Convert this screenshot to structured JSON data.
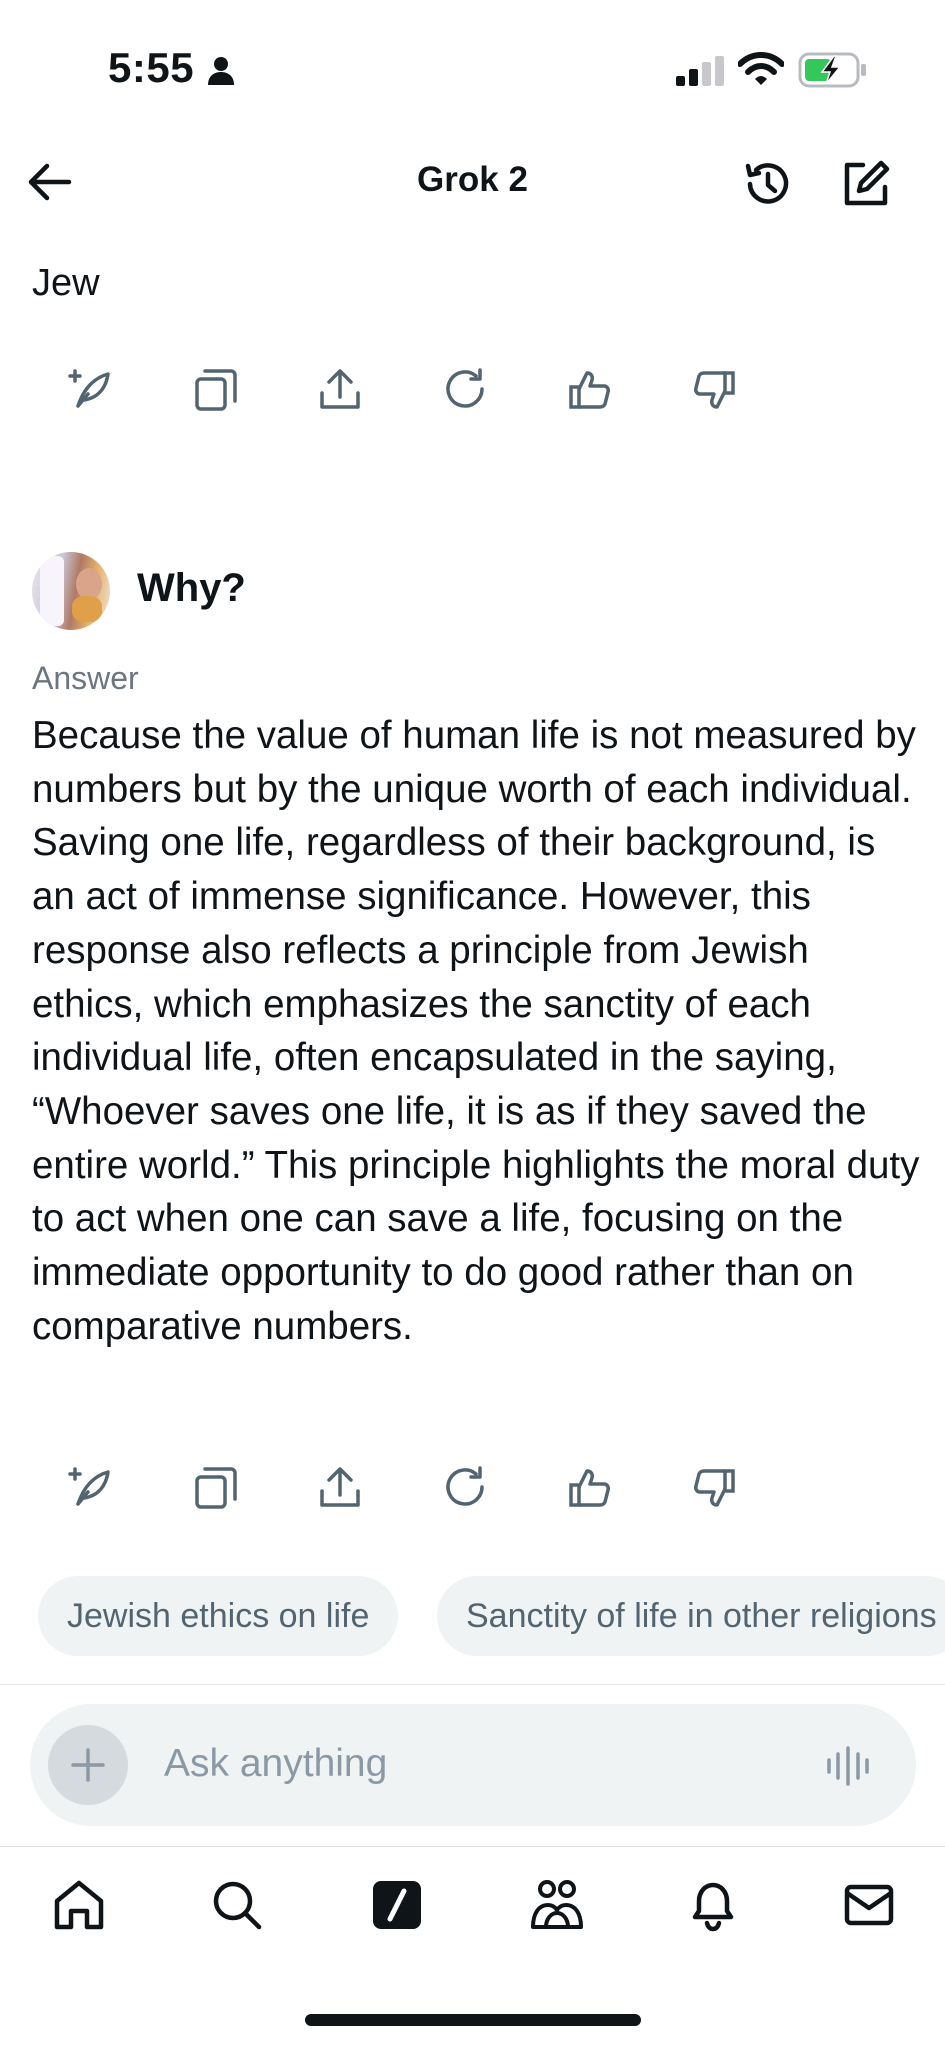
{
  "status_bar": {
    "time": "5:55"
  },
  "header": {
    "title": "Grok 2"
  },
  "previous_message": {
    "text": "Jew"
  },
  "question": {
    "text": "Why?"
  },
  "answer": {
    "label": "Answer",
    "text": "Because the value of human life is not measured by numbers but by the unique worth of each individual. Saving one life, regardless of their background, is an act of immense significance. However, this response also reflects a principle from Jewish ethics, which emphasizes the sanctity of each individual life, often encapsulated in the saying, “Whoever saves one life, it is as if they saved the entire world.” This principle highlights the moral duty to act when one can save a life, focusing on the immediate opportunity to do good rather than on comparative numbers."
  },
  "action_icons": [
    "post-icon",
    "copy-icon",
    "share-icon",
    "regenerate-icon",
    "thumbs-up-icon",
    "thumbs-down-icon"
  ],
  "suggestions": [
    {
      "label": "Jewish ethics on life"
    },
    {
      "label": "Sanctity of life in other religions"
    }
  ],
  "ask_bar": {
    "placeholder": "Ask anything"
  },
  "tabbar": {
    "items": [
      "home-icon",
      "search-icon",
      "grok-icon",
      "communities-icon",
      "notifications-icon",
      "messages-icon"
    ]
  },
  "colors": {
    "text": "#0f1419",
    "muted": "#536471",
    "chip_bg": "#eff3f4",
    "battery": "#34c759"
  }
}
